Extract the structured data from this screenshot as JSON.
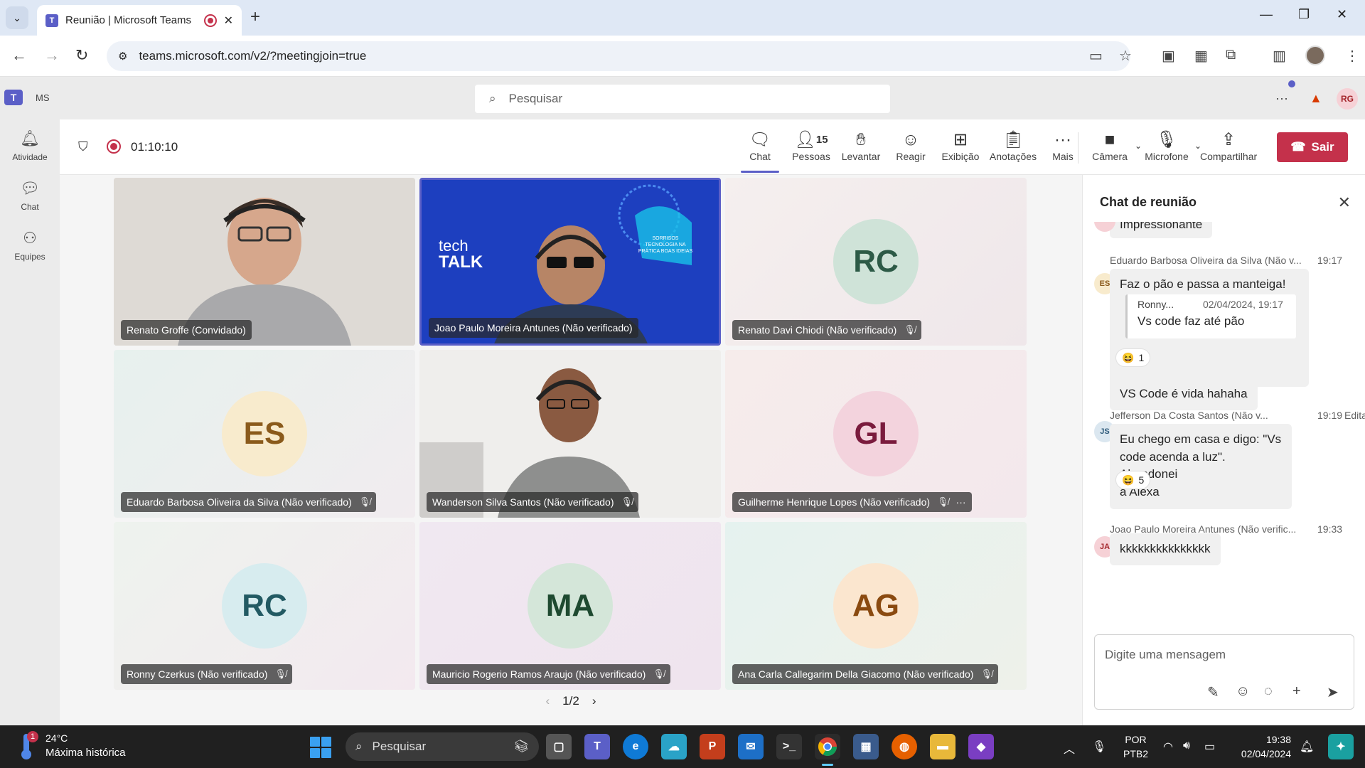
{
  "browser": {
    "tab_title": "Reunião | Microsoft Teams",
    "url": "teams.microsoft.com/v2/?meetingjoin=true"
  },
  "teams": {
    "org": "MS",
    "search_placeholder": "Pesquisar",
    "user_initials": "RG",
    "rail": [
      {
        "label": "Atividade",
        "icon": "bell-icon"
      },
      {
        "label": "Chat",
        "icon": "chat-icon"
      },
      {
        "label": "Equipes",
        "icon": "teams-icon"
      }
    ]
  },
  "meeting": {
    "timer": "01:10:10",
    "toolbar": {
      "chat": "Chat",
      "people": "Pessoas",
      "people_count": "15",
      "raise": "Levantar",
      "react": "Reagir",
      "view": "Exibição",
      "notes": "Anotações",
      "more": "Mais",
      "camera": "Câmera",
      "mic": "Microfone",
      "share": "Compartilhar",
      "leave": "Sair"
    },
    "tiles": [
      {
        "name": "Renato Groffe (Convidado)",
        "initials": "",
        "video": true,
        "muted": false
      },
      {
        "name": "Joao Paulo Moreira Antunes (Não verificado)",
        "initials": "",
        "video": true,
        "muted": false
      },
      {
        "name": "Renato Davi Chiodi (Não verificado)",
        "initials": "RC",
        "video": false,
        "muted": true
      },
      {
        "name": "Eduardo Barbosa Oliveira da Silva (Não verificado)",
        "initials": "ES",
        "video": false,
        "muted": true
      },
      {
        "name": "Wanderson Silva Santos (Não verificado)",
        "initials": "",
        "video": true,
        "muted": true
      },
      {
        "name": "Guilherme Henrique Lopes (Não verificado)",
        "initials": "GL",
        "video": false,
        "muted": true
      },
      {
        "name": "Ronny Czerkus (Não verificado)",
        "initials": "RC",
        "video": false,
        "muted": true
      },
      {
        "name": "Mauricio Rogerio Ramos Araujo (Não verificado)",
        "initials": "MA",
        "video": false,
        "muted": true
      },
      {
        "name": "Ana Carla Callegarim Della Giacomo (Não verificado)",
        "initials": "AG",
        "video": false,
        "muted": true
      }
    ],
    "page": "1/2",
    "tech_talk": {
      "line1": "tech",
      "line2": "TALK",
      "badge": "SORRISOS TECNOLOGIA NA PRÁTICA BOAS IDEIAS"
    }
  },
  "chat": {
    "title": "Chat de reunião",
    "partial_top": "Impressionante",
    "messages": [
      {
        "author": "Eduardo Barbosa Oliveira da Silva (Não v...",
        "time": "19:17",
        "initials": "ES",
        "text": "Faz o pão e passa a manteiga!",
        "quote_author": "Ronny...",
        "quote_time": "02/04/2024, 19:17",
        "quote_text": "Vs code faz até pão",
        "reaction_count": "1",
        "followup": "VS Code é vida hahaha"
      },
      {
        "author": "Jefferson Da Costa Santos (Não v...",
        "time": "19:19",
        "edited": "Editad",
        "initials": "JS",
        "text_lines": [
          "Eu chego em casa e digo: \"Vs",
          "code acenda a luz\". Abandonei",
          "a Alexa"
        ],
        "reaction_count": "5"
      },
      {
        "author": "Joao Paulo Moreira Antunes (Não verific...",
        "time": "19:33",
        "initials": "JA",
        "text": "kkkkkkkkkkkkkkk"
      }
    ],
    "compose_placeholder": "Digite uma mensagem"
  },
  "taskbar": {
    "temp": "24°C",
    "weather_desc": "Máxima histórica",
    "weather_badge": "1",
    "search": "Pesquisar",
    "lang1": "POR",
    "lang2": "PTB2",
    "time": "19:38",
    "date": "02/04/2024"
  }
}
